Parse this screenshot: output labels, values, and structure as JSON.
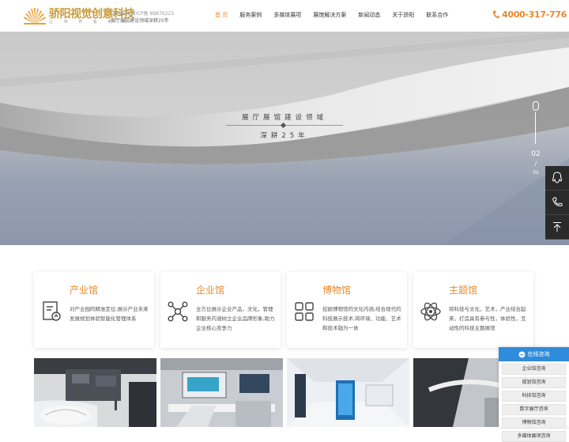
{
  "header": {
    "brand_name": "骄阳视觉创意科技",
    "brand_sub": "让 世 界 看 到 你",
    "cert": "证书编号 粤ICP备 89870223",
    "slogan": "展厅展馆建设领域深耕25年",
    "nav": [
      "首 页",
      "服务案例",
      "多媒体展项",
      "展馆解决方案",
      "新闻动态",
      "关于骄阳",
      "联系合作"
    ],
    "active_nav": 0,
    "hotline": "4000-317-776"
  },
  "hero": {
    "title": "展厅展馆建设领域",
    "subtitle": "深耕25年",
    "current_slide": "02",
    "separator": "/",
    "total_slides": "02"
  },
  "cards": [
    {
      "title": "产业馆",
      "icon": "document-chart-icon",
      "desc": "对产业园的精准定位,展示产业未来发展规划体验智能化管理体系"
    },
    {
      "title": "企业馆",
      "icon": "network-nodes-icon",
      "desc": "全方位展示企业产品，文化，管理和服务内涵树立企业品牌形象,助力企业核心竞争力"
    },
    {
      "title": "博物馆",
      "icon": "grid-squares-icon",
      "desc": "挖掘博物馆的文化内涵,结合现代的科技展示技术,将环境、功能、艺术和技术融为一体"
    },
    {
      "title": "主题馆",
      "icon": "atom-icon",
      "desc": "将科技与文化，艺术，产业结合起来，打造具有参与性，体验性，互动性的科技主题展馆"
    }
  ],
  "consult": {
    "title": "在线咨询",
    "items": [
      "企业馆咨询",
      "规划馆咨询",
      "科技馆咨询",
      "数字展厅咨询",
      "博物馆咨询",
      "多媒体展项咨询"
    ]
  },
  "colors": {
    "accent": "#e8892b",
    "consult_blue": "#2f8bdc",
    "side_btn": "#2a2a2a"
  },
  "side_buttons": [
    "qq-icon",
    "phone-icon",
    "back-to-top-icon"
  ]
}
